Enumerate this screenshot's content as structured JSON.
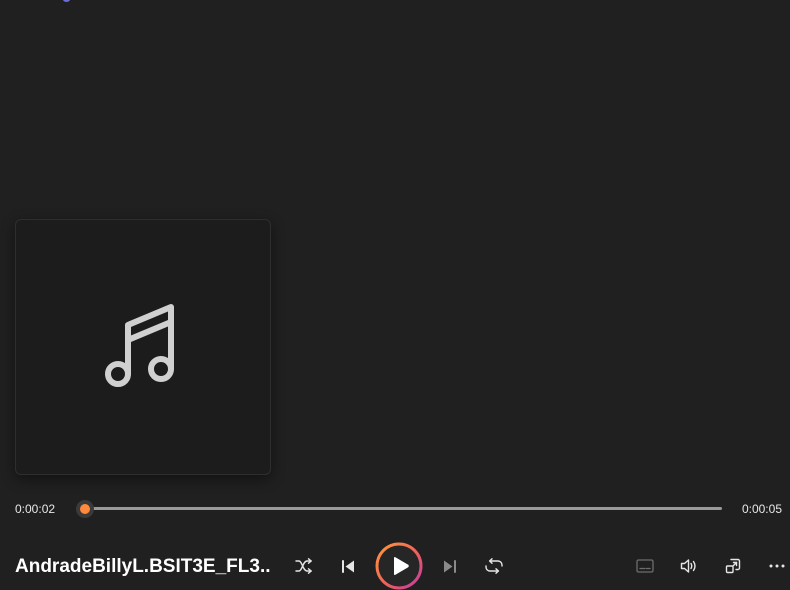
{
  "player": {
    "track_title": "AndradeBillyL.BSIT3E_FL3...",
    "current_time": "0:00:02",
    "total_time": "0:00:05",
    "progress_fraction": 0.0
  },
  "icons": {
    "album_art": "music-note-icon",
    "shuffle": "shuffle-icon",
    "previous": "previous-icon",
    "play": "play-icon",
    "next": "next-icon",
    "repeat": "repeat-icon",
    "captions": "captions-icon",
    "volume": "volume-icon",
    "miniplayer": "miniplayer-icon",
    "more": "more-options-icon"
  },
  "colors": {
    "background": "#202020",
    "accent_orange": "#ff8a3d",
    "accent_pink": "#d5409a",
    "track": "#9a9a9a"
  }
}
